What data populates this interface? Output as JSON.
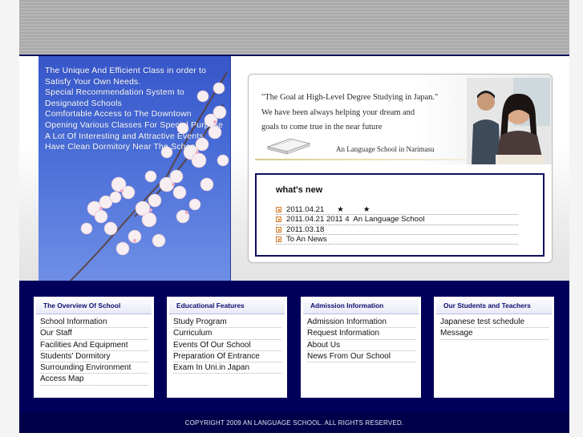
{
  "hero": {
    "lines": [
      "The Unique And Efficient Class in order to",
      "Satisfy Your Own Needs.",
      "Special Recommendation System to",
      "Designated Schools",
      "Comfortable Access to The Downtown",
      "Opening Various Classes For Special Purpose",
      "A Lot Of Interesting and Attractive Events",
      "Have Clean Dormitory Near The School"
    ]
  },
  "banner": {
    "quote_lines": [
      "\"The Goal at High-Level Degree Studying in Japan.\"",
      "We have been always helping your  dream and",
      "goals to come true in the near future"
    ],
    "school": "An Language School in Narimasu"
  },
  "news": {
    "title": "what's new",
    "items": [
      "2011.04.21      ★         ★",
      "2011.04.21 2011 4  An Language School",
      "2011.03.18",
      "To An News"
    ]
  },
  "nav": {
    "columns": [
      {
        "heading": "The Overview Of School",
        "items": [
          "School Information",
          "Our Staff",
          "Facilities And Equipment",
          "Students' Dormitory",
          "Surrounding Environment",
          "Access Map"
        ]
      },
      {
        "heading": "Educational Features",
        "items": [
          "Study Program",
          "Curriculum",
          "Events Of Our School",
          "Preparation Of Entrance",
          "Exam In Uni.in Japan"
        ]
      },
      {
        "heading": "Admission Information",
        "items": [
          "Admission Information",
          "Request Information",
          "About Us",
          "News From Our School"
        ]
      },
      {
        "heading": "Our Students and Teachers",
        "items": [
          "Japanese test schedule",
          "Message"
        ]
      }
    ]
  },
  "footer": {
    "copyright": "COPYRIGHT 2009 AN LANGUAGE SCHOOL. ALL RIGHTS RESERVED."
  },
  "colors": {
    "navy": "#00005a",
    "hero_blue": "#4a6fd8",
    "bullet_orange": "#e07a1d"
  }
}
